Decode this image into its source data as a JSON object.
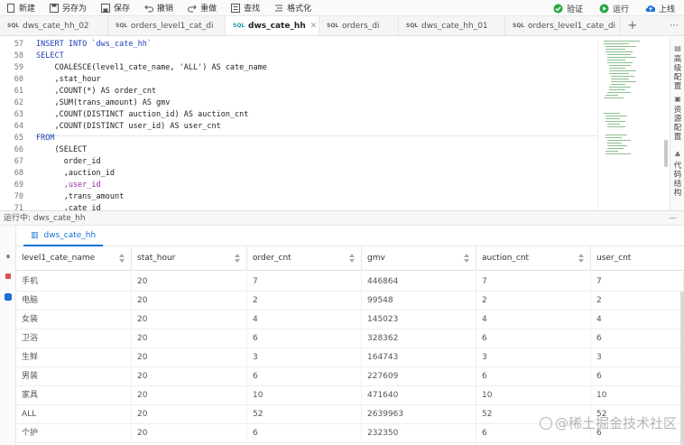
{
  "toolbar": {
    "buttons": [
      {
        "label": "新建",
        "icon": "new-file-icon"
      },
      {
        "label": "另存为",
        "icon": "save-as-icon"
      },
      {
        "label": "保存",
        "icon": "save-icon"
      },
      {
        "label": "撤销",
        "icon": "undo-icon"
      },
      {
        "label": "重做",
        "icon": "redo-icon"
      },
      {
        "label": "查找",
        "icon": "find-icon"
      },
      {
        "label": "格式化",
        "icon": "format-icon"
      }
    ],
    "right": [
      {
        "label": "验证",
        "icon": "verify-icon",
        "color": "#27a745"
      },
      {
        "label": "运行",
        "icon": "run-icon",
        "color": "#27a745"
      },
      {
        "label": "上线",
        "icon": "publish-icon",
        "color": "#1a6fd6"
      }
    ]
  },
  "tabs": [
    {
      "lang": "SQL",
      "label": "dws_cate_hh_02",
      "active": false
    },
    {
      "lang": "SQL",
      "label": "orders_level1_cat_di",
      "active": false
    },
    {
      "lang": "SQL",
      "label": "dws_cate_hh",
      "active": true
    },
    {
      "lang": "SQL",
      "label": "orders_di",
      "active": false
    },
    {
      "lang": "SQL",
      "label": "dws_cate_hh_01",
      "active": false
    },
    {
      "lang": "SQL",
      "label": "orders_level1_cate_di",
      "active": false
    }
  ],
  "editor": {
    "lines": [
      {
        "n": "57",
        "code": "INSERT INTO `dws_cate_hh`"
      },
      {
        "n": "58",
        "code": "SELECT"
      },
      {
        "n": "59",
        "code": "    COALESCE(level1_cate_name, 'ALL') AS cate_name"
      },
      {
        "n": "60",
        "code": "    ,stat_hour"
      },
      {
        "n": "61",
        "code": "    ,COUNT(*) AS order_cnt"
      },
      {
        "n": "62",
        "code": "    ,SUM(trans_amount) AS gmv"
      },
      {
        "n": "63",
        "code": "    ,COUNT(DISTINCT auction_id) AS auction_cnt"
      },
      {
        "n": "64",
        "code": "    ,COUNT(DISTINCT user_id) AS user_cnt"
      },
      {
        "n": "65",
        "code": "FROM"
      },
      {
        "n": "66",
        "code": "    (SELECT"
      },
      {
        "n": "67",
        "code": "      order_id"
      },
      {
        "n": "68",
        "code": "      ,auction_id"
      },
      {
        "n": "69",
        "code": "      ,user_id"
      },
      {
        "n": "70",
        "code": "      ,trans_amount"
      },
      {
        "n": "71",
        "code": "      ,cate_id"
      }
    ]
  },
  "right_panel": [
    {
      "label": "高级配置",
      "icon": "advanced-config-icon"
    },
    {
      "label": "资源配置",
      "icon": "resource-config-icon"
    },
    {
      "label": "代码结构",
      "icon": "code-structure-icon"
    }
  ],
  "status": {
    "text": "运行中: dws_cate_hh"
  },
  "result": {
    "tab_label": "dws_cate_hh",
    "columns": [
      "level1_cate_name",
      "stat_hour",
      "order_cnt",
      "gmv",
      "auction_cnt",
      "user_cnt"
    ],
    "rows": [
      [
        "手机",
        "20",
        "7",
        "446864",
        "7",
        "7"
      ],
      [
        "电脑",
        "20",
        "2",
        "99548",
        "2",
        "2"
      ],
      [
        "女装",
        "20",
        "4",
        "145023",
        "4",
        "4"
      ],
      [
        "卫浴",
        "20",
        "6",
        "328362",
        "6",
        "6"
      ],
      [
        "生鲜",
        "20",
        "3",
        "164743",
        "3",
        "3"
      ],
      [
        "男装",
        "20",
        "6",
        "227609",
        "6",
        "6"
      ],
      [
        "家具",
        "20",
        "10",
        "471640",
        "10",
        "10"
      ],
      [
        "ALL",
        "20",
        "52",
        "2639963",
        "52",
        "52"
      ],
      [
        "个护",
        "20",
        "6",
        "232350",
        "6",
        "6"
      ]
    ]
  },
  "watermark": "@稀土掘金技术社区"
}
